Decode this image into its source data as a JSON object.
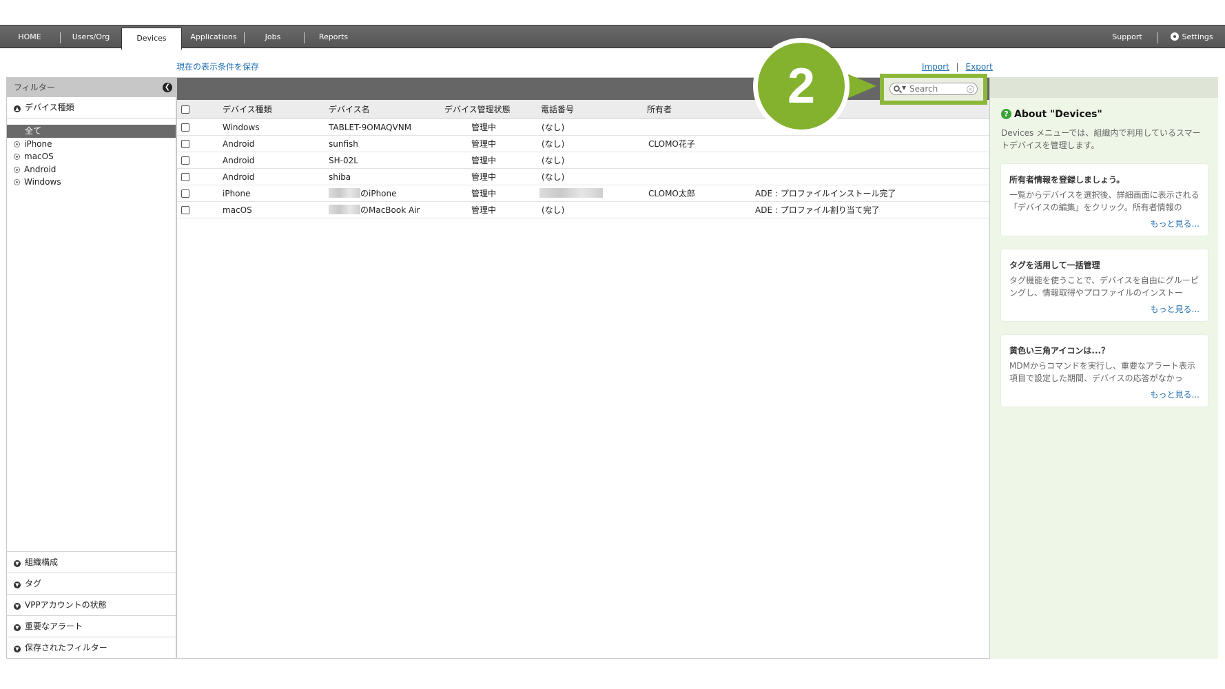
{
  "nav": {
    "items": [
      "HOME",
      "Users/Org",
      "Devices",
      "Applications",
      "Jobs",
      "Reports"
    ],
    "active": "Devices",
    "support": "Support",
    "settings": "Settings"
  },
  "toolbar": {
    "save_view": "現在の表示条件を保存",
    "import": "Import",
    "export": "Export",
    "separator": "|"
  },
  "sidebar": {
    "title": "フィルター",
    "device_type_header": "デバイス種類",
    "device_types": [
      "全て",
      "iPhone",
      "macOS",
      "Android",
      "Windows"
    ],
    "selected_type": "全て",
    "sections": [
      "組織構成",
      "タグ",
      "VPPアカウントの状態",
      "重要なアラート",
      "保存されたフィルター"
    ]
  },
  "search": {
    "placeholder": "Search"
  },
  "callout": {
    "number": "2"
  },
  "table": {
    "headers": [
      "デバイス種類",
      "デバイス名",
      "デバイス管理状態",
      "電話番号",
      "所有者",
      ""
    ],
    "rows": [
      {
        "type": "Windows",
        "name": "TABLET-9OMAQVNM",
        "status": "管理中",
        "phone": "(なし)",
        "owner": "",
        "note": ""
      },
      {
        "type": "Android",
        "name": "sunfish",
        "status": "管理中",
        "phone": "(なし)",
        "owner": "CLOMO花子",
        "note": ""
      },
      {
        "type": "Android",
        "name": "SH-02L",
        "status": "管理中",
        "phone": "(なし)",
        "owner": "",
        "note": ""
      },
      {
        "type": "Android",
        "name": "shiba",
        "status": "管理中",
        "phone": "(なし)",
        "owner": "",
        "note": ""
      },
      {
        "type": "iPhone",
        "name": "のiPhone",
        "status": "管理中",
        "phone": "",
        "owner": "CLOMO太郎",
        "note": "ADE : プロファイルインストール完了"
      },
      {
        "type": "macOS",
        "name": "のMacBook Air",
        "status": "管理中",
        "phone": "(なし)",
        "owner": "",
        "note": "ADE : プロファイル割り当て完了"
      }
    ]
  },
  "about": {
    "title": "About \"Devices\"",
    "description": "Devices メニューでは、組織内で利用しているスマートデバイスを管理します。",
    "cards": [
      {
        "title": "所有者情報を登録しましょう。",
        "body": "一覧からデバイスを選択後、詳細画面に表示される「デバイスの編集」をクリック。所有者情報の",
        "more": "もっと見る..."
      },
      {
        "title": "タグを活用して一括管理",
        "body": "タグ機能を使うことで、デバイスを自由にグルーピングし、情報取得やプロファイルのインストー",
        "more": "もっと見る..."
      },
      {
        "title": "黄色い三角アイコンは...？",
        "body": "MDMからコマンドを実行し、重要なアラート表示項目で設定した期間、デバイスの応答がなかっ",
        "more": "もっと見る..."
      }
    ]
  }
}
